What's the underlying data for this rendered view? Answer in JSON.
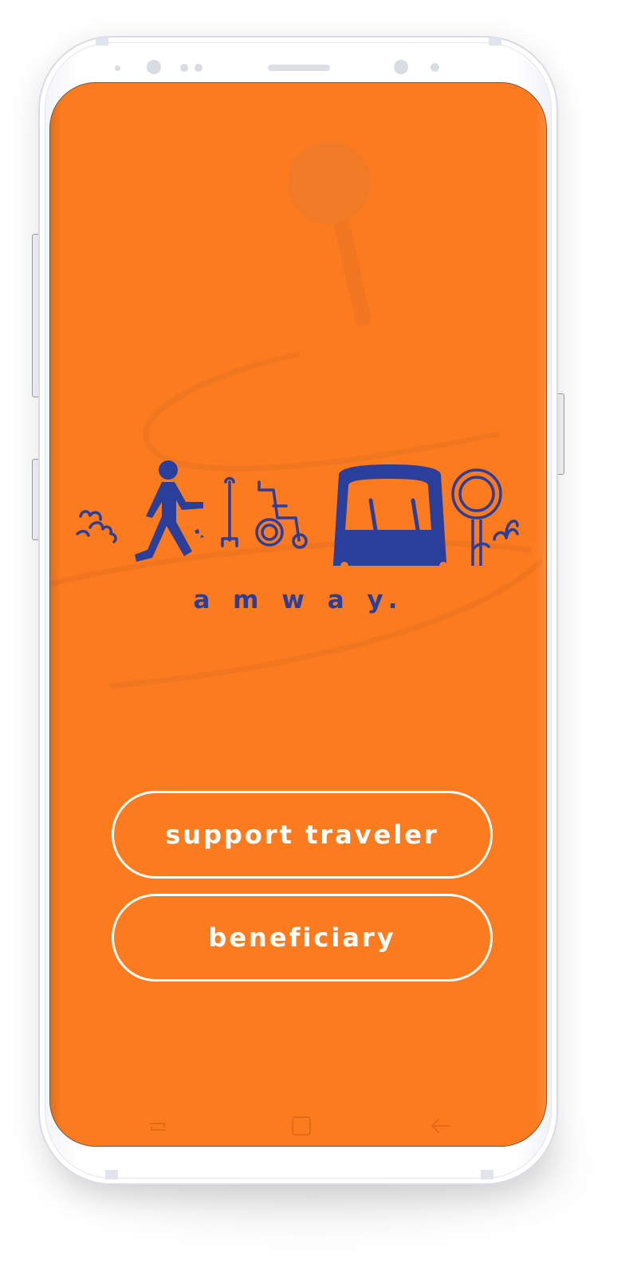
{
  "app": {
    "brand_name": "a m w a y.",
    "colors": {
      "screen_background": "#fc7b1e",
      "brand_blue": "#2a3e9c",
      "button_outline": "#ffffff"
    }
  },
  "illustration": {
    "icons": [
      "bush-icon",
      "pedestrian-icon",
      "walking-cane-icon",
      "wheelchair-icon",
      "bus-icon",
      "bus-stop-sign-icon",
      "map-pin-icon"
    ]
  },
  "actions": {
    "support_traveler_label": "support traveler",
    "beneficiary_label": "beneficiary"
  },
  "navbar": {
    "recents_icon": "recents-icon",
    "home_icon": "home-icon",
    "back_icon": "back-arrow-icon"
  }
}
